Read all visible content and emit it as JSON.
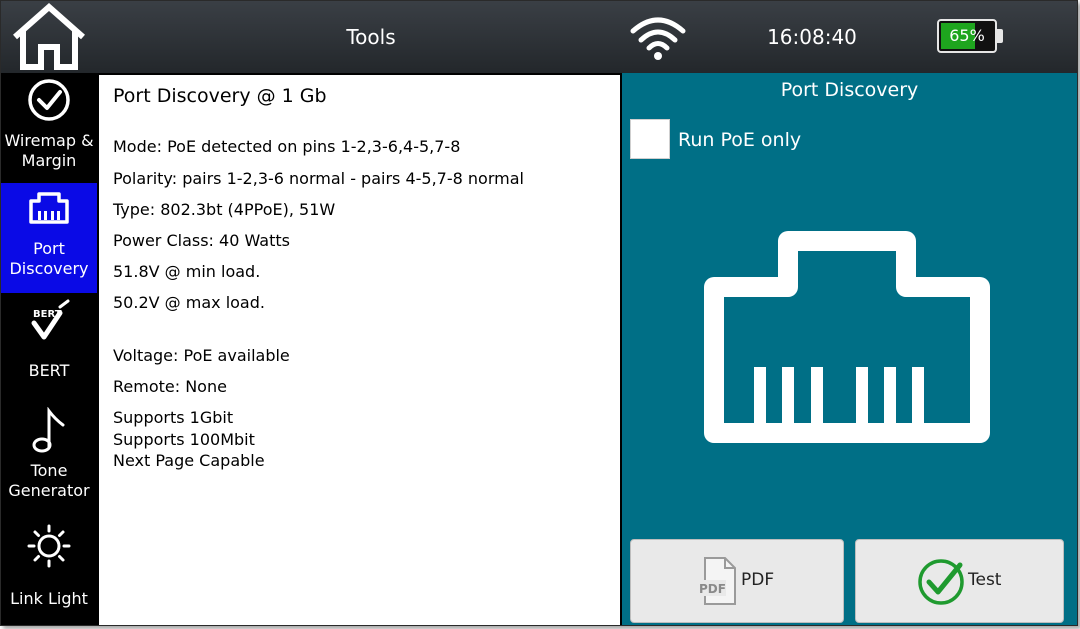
{
  "header": {
    "title": "Tools",
    "time": "16:08:40",
    "battery": {
      "percent_label": "65%",
      "level": 0.65,
      "fill_color": "#1ea51e"
    }
  },
  "sidebar": {
    "items": [
      {
        "label_line1": "Wiremap &",
        "label_line2": "Margin",
        "icon": "check-circle-icon"
      },
      {
        "label_line1": "Port",
        "label_line2": "Discovery",
        "icon": "ethernet-port-icon",
        "active": true
      },
      {
        "label_line1": "BERT",
        "icon_text": "BERT",
        "icon": "bert-icon"
      },
      {
        "label_line1": "Tone",
        "label_line2": "Generator",
        "icon": "music-note-icon"
      },
      {
        "label_line1": "Link Light",
        "icon": "sun-icon"
      }
    ]
  },
  "results": {
    "heading": "Port Discovery @ 1 Gb",
    "lines": [
      "Mode: PoE detected on pins 1-2,3-6,4-5,7-8",
      "Polarity: pairs 1-2,3-6 normal - pairs 4-5,7-8 normal",
      "Type: 802.3bt (4PPoE), 51W",
      "Power Class: 40 Watts",
      "51.8V @ min load.",
      "50.2V @ max load.",
      "Voltage: PoE available",
      "Remote: None",
      "Supports 1Gbit",
      "Supports 100Mbit",
      "Next Page Capable"
    ]
  },
  "panel": {
    "title": "Port Discovery",
    "run_poe_only_label": "Run PoE only",
    "run_poe_only_checked": false,
    "pdf_button_label": "PDF",
    "pdf_icon_text": "PDF",
    "test_button_label": "Test"
  },
  "colors": {
    "panel_bg": "#006f86",
    "sidebar_active": "#0a0ae6",
    "test_check": "#1f9a2f"
  }
}
